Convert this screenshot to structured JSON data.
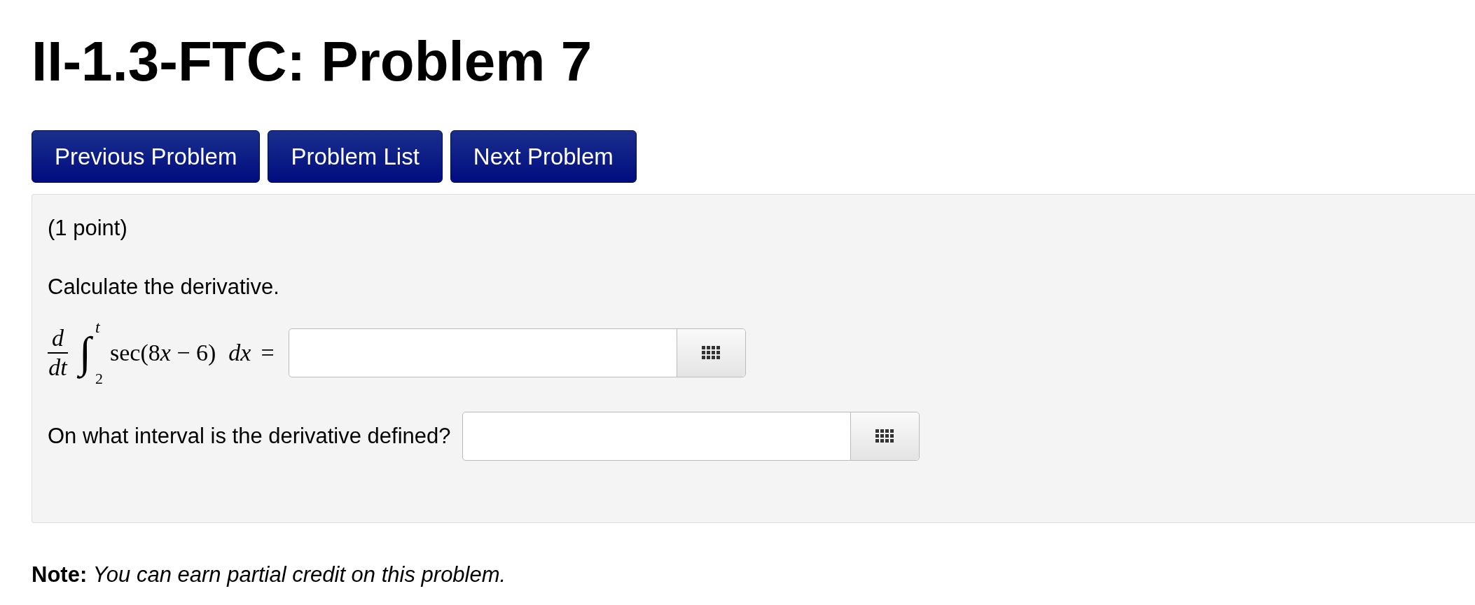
{
  "title": "II-1.3-FTC: Problem 7",
  "nav_buttons": [
    "Previous Problem",
    "Problem List",
    "Next Problem"
  ],
  "problem": {
    "points": "(1 point)",
    "instruction": "Calculate the derivative.",
    "formula": {
      "numerator": "d",
      "denominator": "dt",
      "integral": "∫",
      "upper_limit": "t",
      "lower_limit": "2",
      "integrand_start": "sec(8",
      "variable": "x",
      "integrand_end": "− 6)",
      "differential": "dx",
      "equals": "="
    },
    "answers": [
      {
        "kind": "formula"
      },
      {
        "kind": "question",
        "label": "On what interval is the derivative defined?"
      }
    ]
  },
  "note": "**Note:** *You can earn partial credit on this problem.*"
}
